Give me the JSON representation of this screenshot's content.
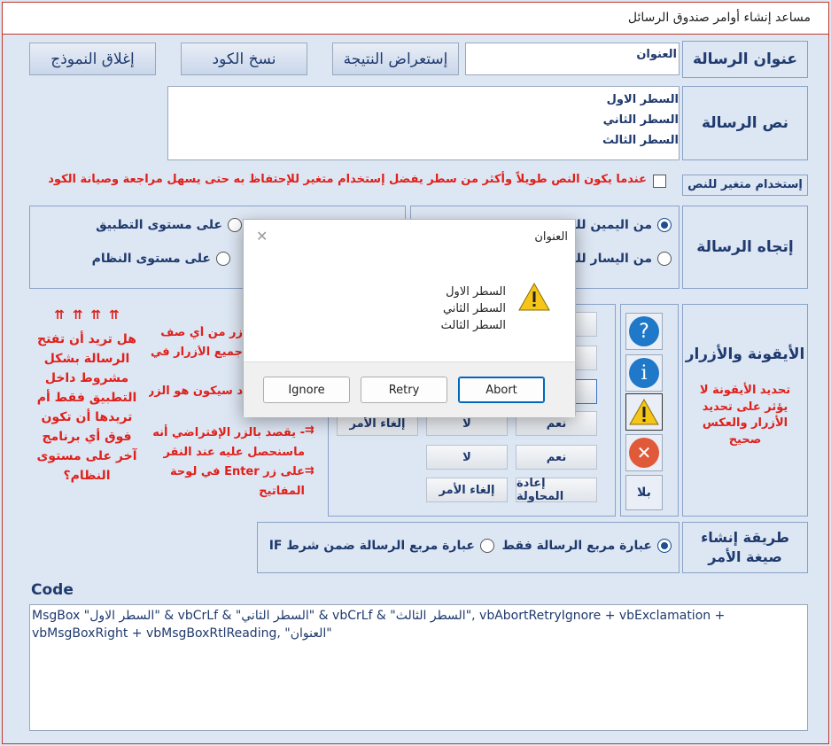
{
  "window": {
    "title": "مساعد إنشاء أوامر صندوق الرسائل"
  },
  "toolbar": {
    "preview_label": "إستعراض النتيجة",
    "copy_label": "نسخ الكود",
    "close_label": "إغلاق النموذج"
  },
  "labels": {
    "msg_title": "عنوان الرسالة",
    "msg_body": "نص الرسالة",
    "use_var": "إستخدام متغير للنص",
    "direction": "إتجاه الرسالة",
    "icons_buttons": "الأيقونة والأزرار",
    "method": "طريقة إنشاء صيغة الأمر",
    "code": "Code"
  },
  "fields": {
    "title_value": "العنوان",
    "body_lines": [
      "السطر الاول",
      "السطر الثاني",
      "السطر الثالث"
    ]
  },
  "notes": {
    "var_hint": "عندما يكون النص طويلاً وأكثر من سطر يفضل إستخدام متغير للإحتفاظ به حتى يسهل مراجعة وصيانة الكود",
    "icon_hint": "تحديد الأيقونة لا يؤثر على تحديد الأزرار والعكس صحيح",
    "arrows": "⇈ ⇈ ⇈ ⇈",
    "scope_question": "هل تريد أن تفتح الرسالة بشكل مشروط داخل التطبيق فقط أم تريدها أن تكون فوق أي برنامج آخر على مستوى النظام؟",
    "partial1": "زر من أي صف",
    "partial2": "جميع الأزرار في",
    "partial3": "د سيكون هو الزر",
    "default_hint": "- يقصد بالزر الإفتراضي أنه ماسنحصل عليه عند النقر على زر Enter في لوحة المفاتيح",
    "arrow_mark": "⇉"
  },
  "direction": {
    "rtl": "من اليمين لليسار",
    "ltr": "من اليسار لليمين"
  },
  "scope": {
    "app": "على مستوى التطبيق",
    "system": "على مستوى النظام"
  },
  "button_sets": {
    "no": "لا",
    "yes": "نعم",
    "cancel": "إلغاء الأمر",
    "retry": "إعادة المحاولة"
  },
  "icons": {
    "none": "بلا",
    "info_glyph": "i",
    "question_glyph": "?",
    "warning_glyph": "!",
    "critical_glyph": "✕"
  },
  "method": {
    "only_msgbox": "عبارة مربع الرسالة فقط",
    "in_if": "عبارة مربع الرسالة ضمن شرط IF"
  },
  "code": {
    "text": "MsgBox \"السطر الاول\" & vbCrLf & \"السطر الثاني\" & vbCrLf & \"السطر الثالث\", vbAbortRetryIgnore + vbExclamation + vbMsgBoxRight + vbMsgBoxRtlReading, \"العنوان\""
  },
  "dialog": {
    "title": "العنوان",
    "lines": [
      "السطر الاول",
      "السطر الثاني",
      "السطر الثالث"
    ],
    "buttons": {
      "abort": "Abort",
      "retry": "Retry",
      "ignore": "Ignore"
    },
    "close_glyph": "✕",
    "warning_glyph": "!"
  },
  "colors": {
    "accent": "#1f3a6e",
    "warn": "#e0201a",
    "bg": "#dde6f3"
  }
}
